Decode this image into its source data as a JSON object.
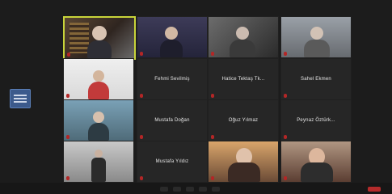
{
  "participants": {
    "row2_col2_name": "Fehmi Sevilmiş",
    "row2_col3_name": "Hatice Tektaş Tk...",
    "row2_col4_name": "Sahel Ekmen",
    "row3_col2_name": "Mustafa Doğan",
    "row3_col3_name": "Oğuz Yılmaz",
    "row3_col4_name": "Peynaz Öztürk...",
    "row4_col2_name": "Mustafa Yıldız"
  },
  "colors": {
    "active_speaker_border": "#c8d43a",
    "background": "#1c1c1c",
    "tile_bg": "#262626",
    "record_red": "#b52b2b"
  },
  "icons": {
    "side_panel_toggle": "list-icon",
    "mic_muted": "mic-muted-icon"
  }
}
